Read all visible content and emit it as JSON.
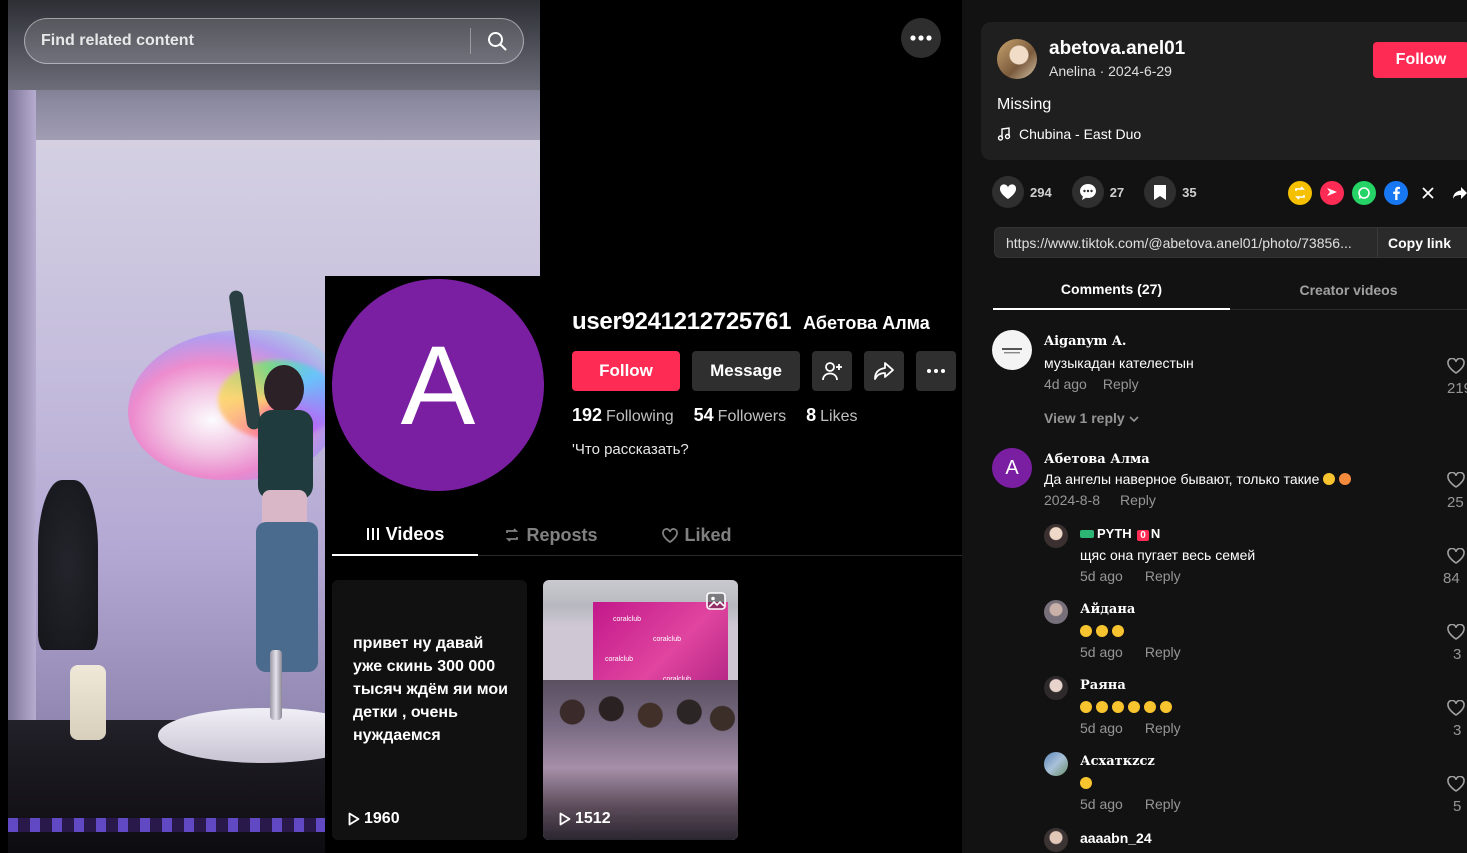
{
  "search": {
    "placeholder": "Find related content"
  },
  "profile": {
    "avatar_letter": "A",
    "username": "user9241212725761",
    "display_name": "Абетова Алма",
    "follow_label": "Follow",
    "message_label": "Message",
    "stats": [
      {
        "value": "192",
        "label": "Following"
      },
      {
        "value": "54",
        "label": "Followers"
      },
      {
        "value": "8",
        "label": "Likes"
      }
    ],
    "bio": "'Что рассказать?",
    "tabs": [
      "Videos",
      "Reposts",
      "Liked"
    ],
    "videos": [
      {
        "text": "привет  ну давай уже скинь 300 000 тысяч ждём яи мои детки , очень нуждаемся",
        "views": "1960"
      },
      {
        "views": "1512",
        "banner_word": "coralclub"
      }
    ]
  },
  "post": {
    "author_username": "abetova.anel01",
    "author_nickname": "Anelina",
    "date": "2024-6-29",
    "author_sub": "Anelina · 2024-6-29",
    "follow_label": "Follow",
    "caption": "Missing",
    "music": "Chubina - East Duo",
    "likes": "294",
    "comments": "27",
    "saves": "35",
    "link": "https://www.tiktok.com/@abetova.anel01/photo/73856...",
    "copy_link_label": "Copy link"
  },
  "right_tabs": [
    "Comments (27)",
    "Creator videos"
  ],
  "comments": [
    {
      "name": "Aiganym A.",
      "text": "музыкадан кателестын",
      "time": "4d ago",
      "reply": "Reply",
      "likes": "219",
      "view_reply": "View 1 reply"
    },
    {
      "name": "Абетова Алма",
      "avatar_letter": "A",
      "text": "Да ангелы наверное бывают, только такие",
      "time": "2024-8-8",
      "reply": "Reply",
      "likes": "25"
    },
    {
      "name": "PYTH",
      "name_tag": "0",
      "name_suffix": "N",
      "text": "щяс она пугает весь семей",
      "time": "5d ago",
      "reply": "Reply",
      "likes": "84"
    },
    {
      "name": "Айдана",
      "time": "5d ago",
      "reply": "Reply",
      "likes": "3"
    },
    {
      "name": "Раяна",
      "time": "5d ago",
      "reply": "Reply",
      "likes": "3"
    },
    {
      "name": "Асхаткzcz",
      "time": "5d ago",
      "reply": "Reply",
      "likes": "5"
    },
    {
      "name": "aaaabn_24"
    }
  ],
  "colors": {
    "accent_red": "#fe2c55",
    "profile_avatar": "#7b1fa2",
    "panel_bg": "#121212",
    "card_bg": "#1f1f1f"
  },
  "icons": {
    "search": "search-icon",
    "more": "more-dots-icon",
    "add_friend": "add-friend-icon",
    "share": "share-icon",
    "like": "heart-icon",
    "comment": "comment-icon",
    "save": "bookmark-icon",
    "music": "music-note-icon"
  }
}
